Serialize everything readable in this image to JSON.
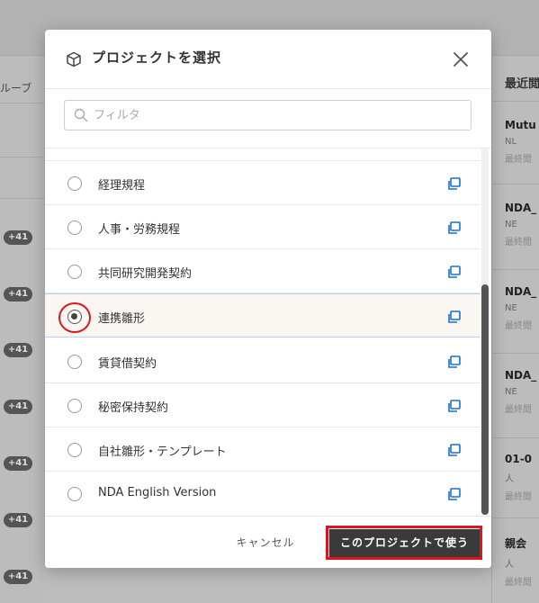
{
  "background": {
    "left_header": "ルーブ",
    "badges": [
      "+41",
      "+41",
      "+41",
      "+41",
      "+41",
      "+41",
      "+41"
    ],
    "right_header": "最近閲",
    "right_cards": [
      {
        "title": "Mutu",
        "sub": "NL",
        "meta": "最終閲"
      },
      {
        "title": "NDA_",
        "sub": "NE",
        "meta": "最終閲"
      },
      {
        "title": "NDA_",
        "sub": "NE",
        "meta": "最終閲"
      },
      {
        "title": "NDA_",
        "sub": "NE",
        "meta": "最終閲"
      },
      {
        "title": "01-0",
        "sub": "人",
        "meta": "最終閲"
      },
      {
        "title": "親会",
        "sub": "人",
        "meta": "最終閲"
      }
    ]
  },
  "modal": {
    "title": "プロジェクトを選択",
    "filter": {
      "placeholder": "フィルタ",
      "value": ""
    },
    "projects": [
      {
        "label": "経理規程",
        "selected": false
      },
      {
        "label": "人事・労務規程",
        "selected": false
      },
      {
        "label": "共同研究開発契約",
        "selected": false
      },
      {
        "label": "連携雛形",
        "selected": true
      },
      {
        "label": "賃貸借契約",
        "selected": false
      },
      {
        "label": "秘密保持契約",
        "selected": false
      },
      {
        "label": "自社雛形・テンプレート",
        "selected": false
      },
      {
        "label": "NDA English Version",
        "selected": false
      }
    ],
    "cancel_label": "キャンセル",
    "confirm_label": "このプロジェクトで使う"
  },
  "colors": {
    "accent_red": "#e0121b",
    "link_blue": "#1a6fd1",
    "primary_button": "#3a3a3a"
  }
}
